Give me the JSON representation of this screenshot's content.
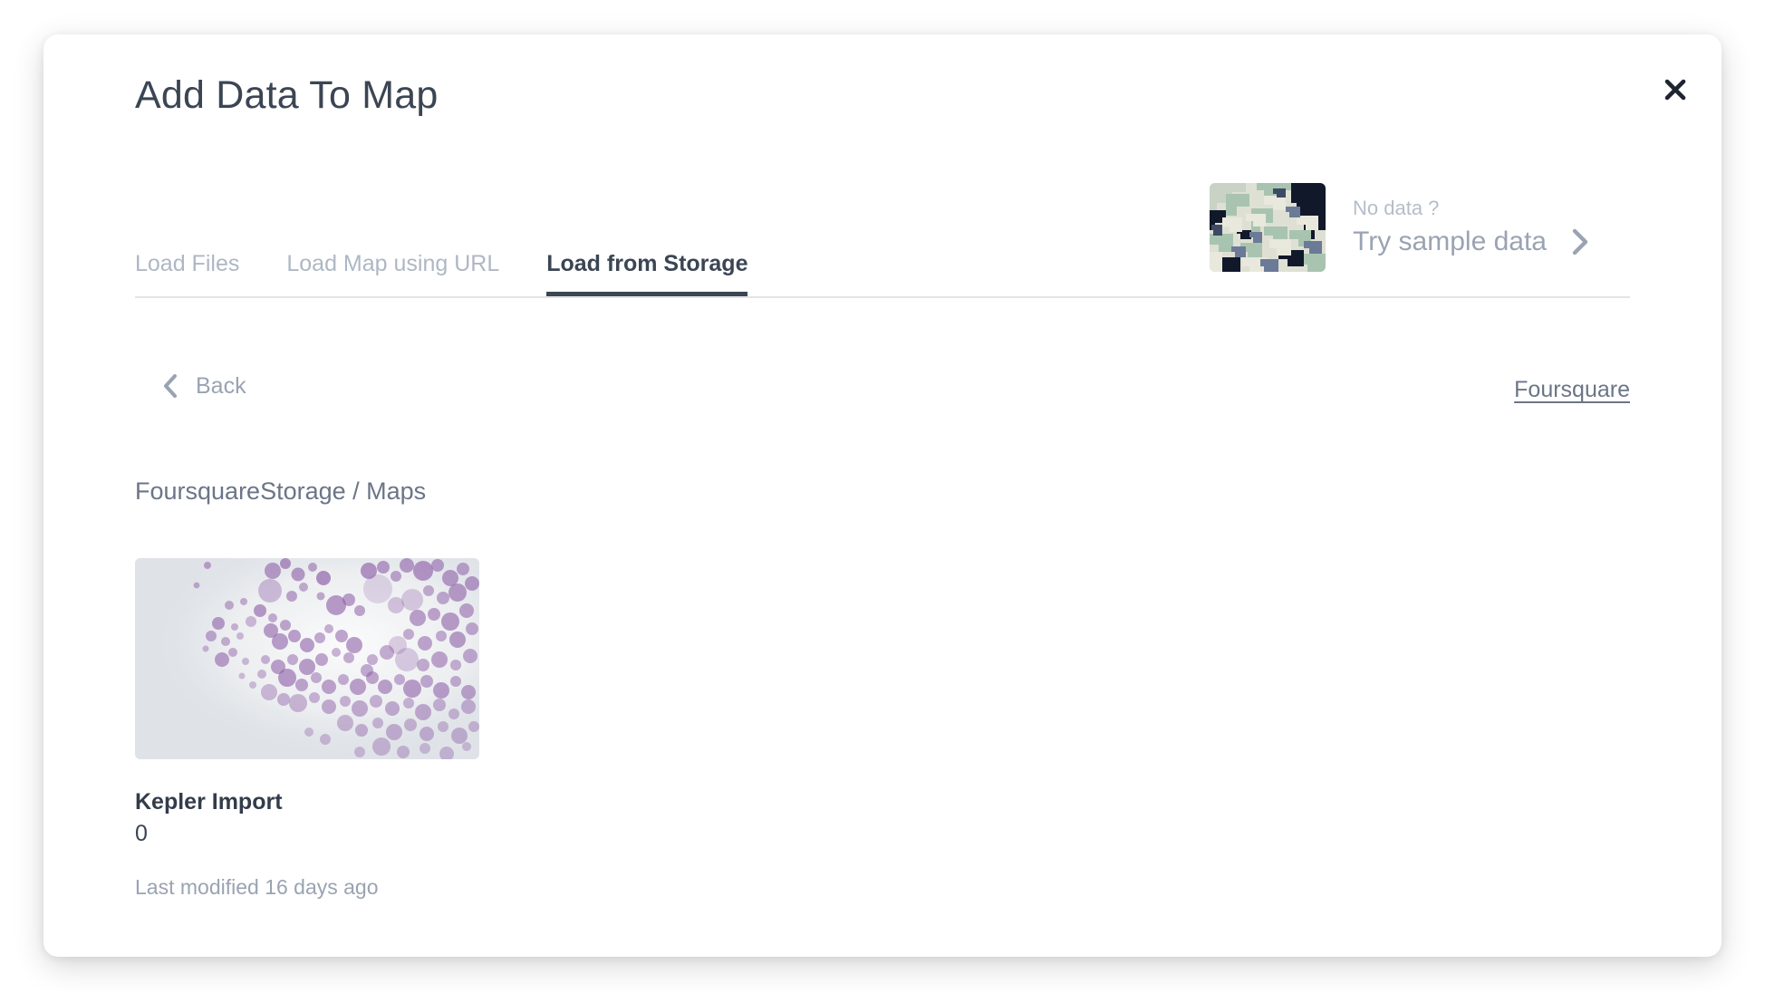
{
  "modal": {
    "title": "Add Data To Map",
    "close_icon": "close-icon"
  },
  "tabs": [
    {
      "label": "Load Files",
      "active": false
    },
    {
      "label": "Load Map using URL",
      "active": false
    },
    {
      "label": "Load from Storage",
      "active": true
    }
  ],
  "sample_promo": {
    "no_data_label": "No data ?",
    "try_sample_label": "Try sample data",
    "chevron_icon": "chevron-right-icon",
    "thumbnail_icon": "sample-map-thumbnail"
  },
  "nav": {
    "back_label": "Back",
    "back_icon": "chevron-left-icon",
    "storage_link_label": "Foursquare"
  },
  "breadcrumb": "FoursquareStorage / Maps",
  "cards": [
    {
      "title": "Kepler Import",
      "count": "0",
      "modified": "Last modified 16 days ago",
      "thumbnail_icon": "purple-dot-map-thumbnail"
    }
  ],
  "colors": {
    "text_dark": "#3b4553",
    "text_muted": "#9aa3b2",
    "tab_inactive": "#aeb7c4",
    "divider": "#e2e4e8",
    "card_thumb_bg": "#dfe3e8",
    "accent_purple": "#8e5fa8",
    "sample_navy": "#11182a",
    "sample_green": "#a8c4b0",
    "sample_cream": "#dfe0d4"
  }
}
